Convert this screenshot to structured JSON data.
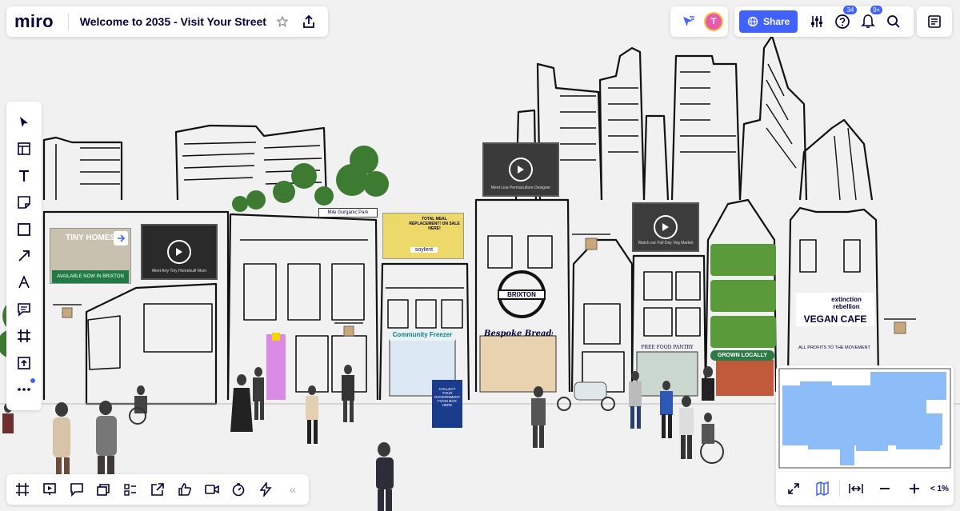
{
  "app": {
    "logo": "miro",
    "board_title": "Welcome to 2035 - Visit Your Street"
  },
  "header": {
    "share_label": "Share",
    "avatar_initial": "T",
    "help_badge": "34",
    "notifications_badge": "9+"
  },
  "toolbar": {
    "items": [
      {
        "name": "select-tool",
        "icon": "cursor-icon"
      },
      {
        "name": "templates-tool",
        "icon": "template-icon"
      },
      {
        "name": "text-tool",
        "icon": "text-icon"
      },
      {
        "name": "sticky-note-tool",
        "icon": "sticky-note-icon"
      },
      {
        "name": "shape-tool",
        "icon": "square-icon"
      },
      {
        "name": "connection-line-tool",
        "icon": "arrow-icon"
      },
      {
        "name": "pen-tool",
        "icon": "pen-icon"
      },
      {
        "name": "comment-tool",
        "icon": "comment-icon"
      },
      {
        "name": "frame-tool",
        "icon": "frame-icon"
      },
      {
        "name": "upload-tool",
        "icon": "upload-icon"
      },
      {
        "name": "more-tools",
        "icon": "more-icon"
      }
    ]
  },
  "bottom_toolbar": {
    "items": [
      "frames-icon",
      "presentation-icon",
      "comments-icon",
      "cards-icon",
      "list-icon",
      "share-screen-icon",
      "reactions-icon",
      "video-call-icon",
      "timer-icon",
      "voting-icon"
    ],
    "collapse_label": "«"
  },
  "zoom": {
    "level": "< 1%"
  },
  "colors": {
    "accent": "#4262ff",
    "badge": "#4262ff",
    "minimap_fill": "#7ab2f7"
  },
  "canvas": {
    "videos": [
      {
        "caption": "Meet Arty Tiny Homebuilt Mum"
      },
      {
        "caption": "Meet Lisa Permaculture Designer"
      },
      {
        "caption": "Watch our Full Day Veg Market"
      }
    ],
    "signs": {
      "tiny_homes": "TINY HOMES",
      "tiny_homes_sub": "AVAILABLE NOW IN BRIXTON",
      "orgamic_park": "Mile Gurganic Park",
      "soylent": "TOTAL MEAL REPLACEMENT! ON SALE HERE!",
      "soylent_brand": "soylent",
      "community_freezer": "Community Freezer",
      "brixton": "BRIXTON",
      "bespoke_breads": "Bespoke Breads",
      "free_food_pantry": "FREE FOOD PANTRY",
      "grown_locally": "GROWN LOCALLY",
      "extinction_rebellion": "extinction rebellion",
      "vegan_cafe": "VEGAN CAFE",
      "all_profits": "ALL PROFITS TO THE MOVEMENT",
      "collect_food_box": "COLLECT YOUR GOVERNMENT FOOD BOX HERE"
    }
  }
}
